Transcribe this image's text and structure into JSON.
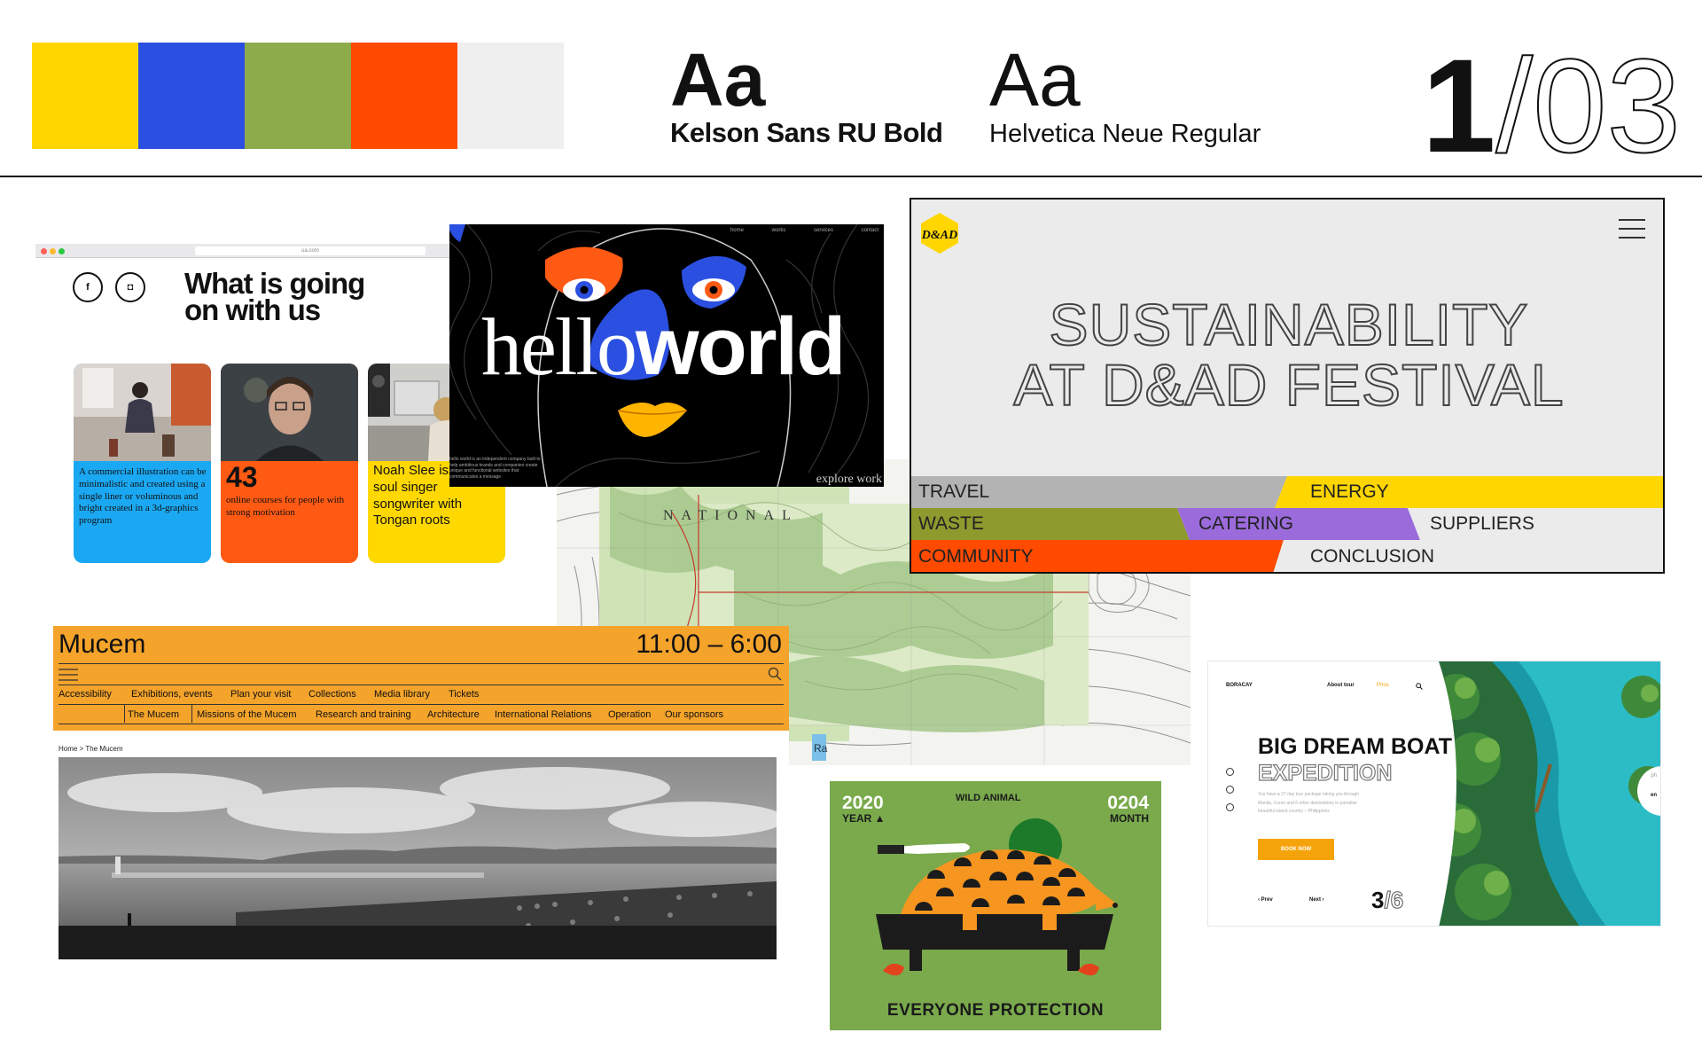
{
  "palette": [
    "#FFD600",
    "#2B4FE0",
    "#8EAB4C",
    "#FF4A00",
    "#EFEFEF"
  ],
  "typography": {
    "heading_sample": "Aa",
    "heading_font": "Kelson Sans RU Bold",
    "body_sample": "Aa",
    "body_font": "Helvetica Neue Regular"
  },
  "page_number": {
    "current": "1",
    "rest": "/03"
  },
  "card_ua": {
    "url": "ua.com",
    "social_1": "f",
    "social_2": "◘",
    "headline_line1": "What is going",
    "headline_line2": "on with us",
    "tiles": [
      {
        "color": "#1ba8f2",
        "text": "A commercial illustration can be minimalistic and created using a single liner or voluminous and bright created in a 3d-graphics program"
      },
      {
        "color": "#ff5a14",
        "big": "43",
        "text": "online courses for people with strong motivation"
      },
      {
        "color": "#ffd800",
        "text": "Noah Slee is a neo-soul singer songwriter with Tongan roots"
      }
    ]
  },
  "card_hello": {
    "nav": "home works services contact",
    "hello_light": "hello",
    "hello_heavy": "world",
    "blurb": "hello world is an independent company built to help ambitious brands and companies create unique and functional websites that communicates a message",
    "explore": "explore work"
  },
  "card_map": {
    "map_label": "NATIONAL",
    "side_label": "Ra"
  },
  "card_dad": {
    "title_line1": "SUSTAINABILITY",
    "title_line2": "AT D&AD FESTIVAL",
    "labels": {
      "travel": "TRAVEL",
      "energy": "ENERGY",
      "waste": "WASTE",
      "catering": "CATERING",
      "suppliers": "SUPPLIERS",
      "community": "COMMUNITY",
      "conclusion": "CONCLUSION"
    },
    "colors": {
      "yellow": "#FFD600",
      "olive": "#8E9A2E",
      "purple": "#9B6BDB",
      "red": "#FF4A00",
      "gray": "#B3B3B3"
    }
  },
  "card_mucem": {
    "name": "Mucem",
    "hours": "11:00 – 6:00",
    "nav_primary": [
      "Accessibility",
      "Exhibitions, events",
      "Plan your visit",
      "Collections",
      "Media library",
      "Tickets"
    ],
    "nav_secondary": [
      "The Mucem",
      "Missions of the Mucem",
      "Research and training",
      "Architecture",
      "International Relations",
      "Operation",
      "Our sponsors"
    ],
    "breadcrumb": "Home > The Mucem",
    "bar_color": "#F4A32B"
  },
  "card_bora": {
    "brand": "BORACAY",
    "nav_about": "About tour",
    "nav_price": "Price",
    "title_line1": "BIG DREAM BOAT",
    "title_line2": "EXPEDITION",
    "description_1": "You have a 27 day tour package taking you through",
    "description_2": "Manila, Coron and 6 other destinations in paradise",
    "description_3": "beautiful island country – Philippines",
    "book_label": "BOOK NOW",
    "prev": "Prev",
    "next": "Next",
    "counter_current": "3",
    "counter_total": "/6",
    "lang_1": "ph",
    "lang_2": "en"
  },
  "card_wild": {
    "year": "2020",
    "year_label": "YEAR ▲",
    "title": "WILD ANIMAL",
    "month": "0204",
    "month_label": "MONTH",
    "bottom": "EVERYONE PROTECTION"
  }
}
